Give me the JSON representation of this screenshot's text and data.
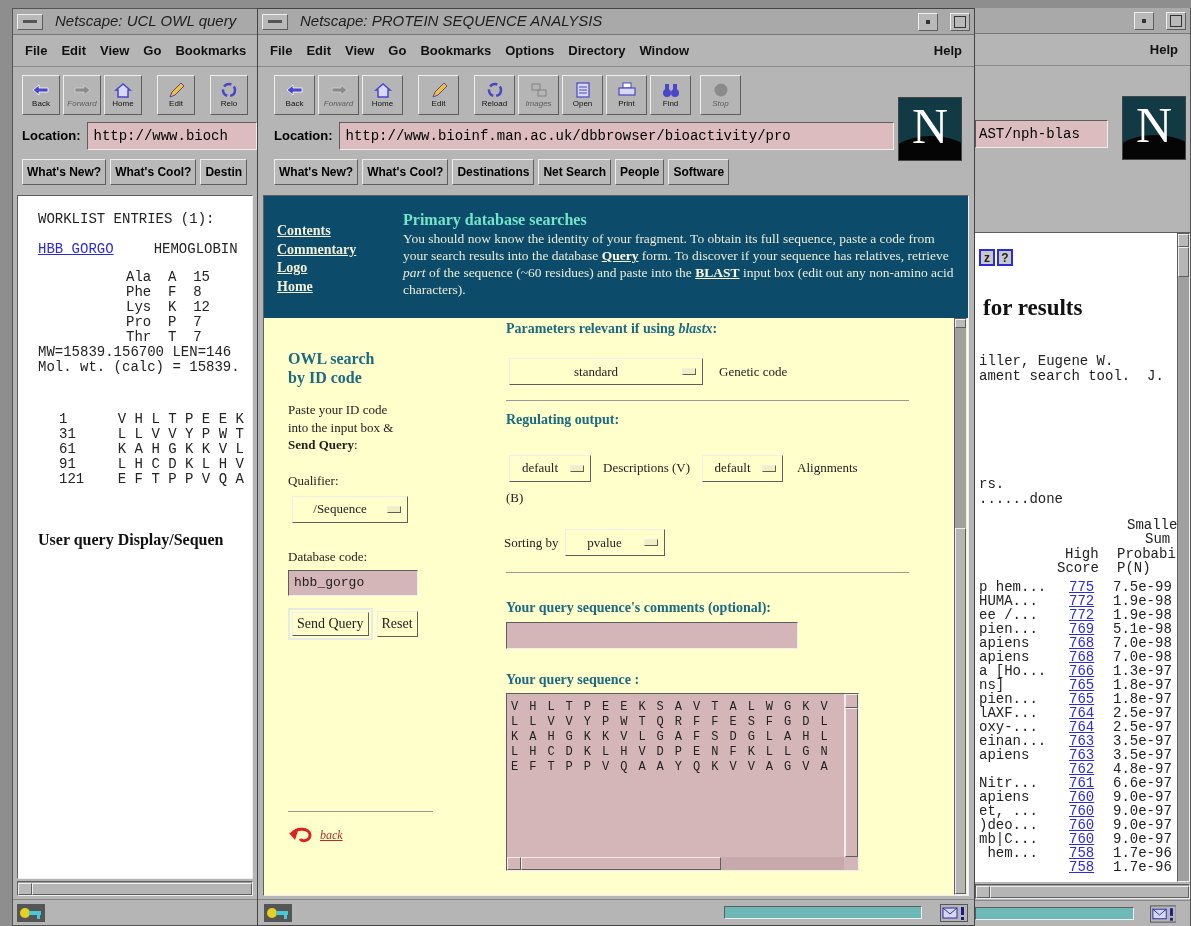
{
  "left_window": {
    "title": "Netscape: UCL OWL query",
    "menu": [
      "File",
      "Edit",
      "View",
      "Go",
      "Bookmarks"
    ],
    "toolbar": [
      {
        "label": "Back",
        "disabled": false
      },
      {
        "label": "Forward",
        "disabled": true
      },
      {
        "label": "Home",
        "disabled": false
      },
      {
        "label": "Edit",
        "disabled": false
      },
      {
        "label": "Relo",
        "disabled": false
      }
    ],
    "location": {
      "label": "Location:",
      "value": "http://www.bioch"
    },
    "directory_buttons": [
      "What's New?",
      "What's Cool?",
      "Destin"
    ],
    "content": {
      "heading": "WORKLIST ENTRIES (1):",
      "entry_link": "HBB_GORGO",
      "entry_name": "HEMOGLOBIN",
      "composition": [
        "Ala  A  15",
        "Phe  F  8",
        "Lys  K  12",
        "Pro  P  7",
        "Thr  T  7"
      ],
      "mw_line": "MW=15839.156700 LEN=146",
      "mol_wt_line": "Mol. wt. (calc) = 15839.",
      "sequence": [
        "1      V H L T P E E K",
        "31     L L V V Y P W T",
        "61     K A H G K K V L",
        "91     L H C D K L H V",
        "121    E F T P P V Q A"
      ],
      "section_title": "User query Display/Sequen"
    }
  },
  "front_window": {
    "title": "Netscape: PROTEIN SEQUENCE ANALYSIS",
    "menu": [
      "File",
      "Edit",
      "View",
      "Go",
      "Bookmarks",
      "Options",
      "Directory",
      "Window"
    ],
    "help_menu": "Help",
    "toolbar": [
      {
        "label": "Back",
        "disabled": false
      },
      {
        "label": "Forward",
        "disabled": true
      },
      {
        "label": "Home",
        "disabled": false
      },
      {
        "label": "Edit",
        "disabled": false
      },
      {
        "label": "Reload",
        "disabled": false
      },
      {
        "label": "Images",
        "disabled": true
      },
      {
        "label": "Open",
        "disabled": false
      },
      {
        "label": "Print",
        "disabled": false
      },
      {
        "label": "Find",
        "disabled": false
      },
      {
        "label": "Stop",
        "disabled": true
      }
    ],
    "location": {
      "label": "Location:",
      "value": "http://www.bioinf.man.ac.uk/dbbrowser/bioactivity/pro"
    },
    "directory_buttons": [
      "What's New?",
      "What's Cool?",
      "Destinations",
      "Net Search",
      "People",
      "Software"
    ],
    "logo": "N",
    "nav_links": [
      "Contents",
      "Commentary",
      "Logo",
      "Home"
    ],
    "intro": {
      "heading": "Primary database searches",
      "paragraph": [
        {
          "text": "You should now know the identity of your fragment. To obtain its full sequence, paste a code from your search results into the database "
        },
        {
          "link": "Query"
        },
        {
          "text": " form. To discover if your sequence has relatives, retrieve *part* of the sequence (~60 residues) and paste into the "
        },
        {
          "link": "BLAST"
        },
        {
          "text": " input box (edit out any non-amino acid characters)."
        }
      ]
    },
    "id_search": {
      "heading": "OWL search by ID code",
      "instructions": "Paste your ID code into the input box & **Send Query**:",
      "qualifier_label": "Qualifier:",
      "qualifier": "/Sequence",
      "code_label": "Database code:",
      "code_value": "hbb_gorgo",
      "buttons": [
        "Send Query",
        "Reset"
      ],
      "back_link": "back"
    },
    "blast_form": {
      "params_label": "Parameters relevant if using *blastx*:",
      "genetic_code": "standard",
      "genetic_code_label": "Genetic code",
      "output_heading": "Regulating output:",
      "descriptions": "default",
      "descriptions_label": "Descriptions (V)",
      "alignments": "default",
      "alignments_label": "Alignments",
      "alignments_suffix": "(B)",
      "sorting_label": "Sorting by",
      "sorting": "pvalue",
      "comments_label": "Your query sequence's comments (optional):",
      "sequence_label": "Your query sequence :",
      "sequence": [
        "V H L T P E E K S A V T A L W G K V",
        "L L V V Y P W T Q R F F E S F G D L",
        "K A H G K K V L G A F S D G L A H L",
        "L H C D K L H V D P E N F K L L G N",
        "E F T P P V Q A A Y Q K V V A G V A"
      ]
    },
    "status_bar": {
      "progress": {
        "level": 1
      }
    }
  },
  "right_window": {
    "help_menu": "Help",
    "location_value": "AST/nph-blas",
    "logo": "N",
    "content": {
      "buttons": [
        "z",
        "?"
      ],
      "heading": "for results",
      "citation": [
        "iller, Eugene W.",
        "ament search tool.  J."
      ],
      "progress_lines": [
        "rs.",
        "......done"
      ],
      "headers": {
        "line_1": "Smalle",
        "line_2": "Sum",
        "score_1": "High",
        "prob_1": "Probabi",
        "score_2": "Score",
        "prob_2": "P(N)"
      },
      "rows": [
        {
          "description": "p hem...",
          "score": "775",
          "p": "7.5e-99"
        },
        {
          "description": "HUMA...",
          "score": "772",
          "p": "1.9e-98"
        },
        {
          "description": "ee /...",
          "score": "772",
          "p": "1.9e-98"
        },
        {
          "description": "pien...",
          "score": "769",
          "p": "5.1e-98"
        },
        {
          "description": "apiens",
          "score": "768",
          "p": "7.0e-98"
        },
        {
          "description": "apiens",
          "score": "768",
          "p": "7.0e-98"
        },
        {
          "description": "a [Ho...",
          "score": "766",
          "p": "1.3e-97"
        },
        {
          "description": "ns]",
          "score": "765",
          "p": "1.8e-97"
        },
        {
          "description": "pien...",
          "score": "765",
          "p": "1.8e-97"
        },
        {
          "description": "lAXF...",
          "score": "764",
          "p": "2.5e-97"
        },
        {
          "description": "oxy-...",
          "score": "764",
          "p": "2.5e-97"
        },
        {
          "description": "einan...",
          "score": "763",
          "p": "3.5e-97"
        },
        {
          "description": "apiens",
          "score": "763",
          "p": "3.5e-97"
        },
        {
          "score": "762",
          "p": "4.8e-97"
        },
        {
          "description": "Nitr...",
          "score": "761",
          "p": "6.6e-97"
        },
        {
          "description": "apiens",
          "score": "760",
          "p": "9.0e-97"
        },
        {
          "description": "et, ...",
          "score": "760",
          "p": "9.0e-97"
        },
        {
          "description": ")deo...",
          "score": "760",
          "p": "9.0e-97"
        },
        {
          "description": "mb|C...",
          "score": "760",
          "p": "9.0e-97"
        },
        {
          "description": " hem...",
          "score": "758",
          "p": "1.7e-96"
        },
        {
          "score": "758",
          "p": "1.7e-96"
        }
      ]
    },
    "status_bar": {
      "progress": {
        "level": 1
      }
    }
  }
}
